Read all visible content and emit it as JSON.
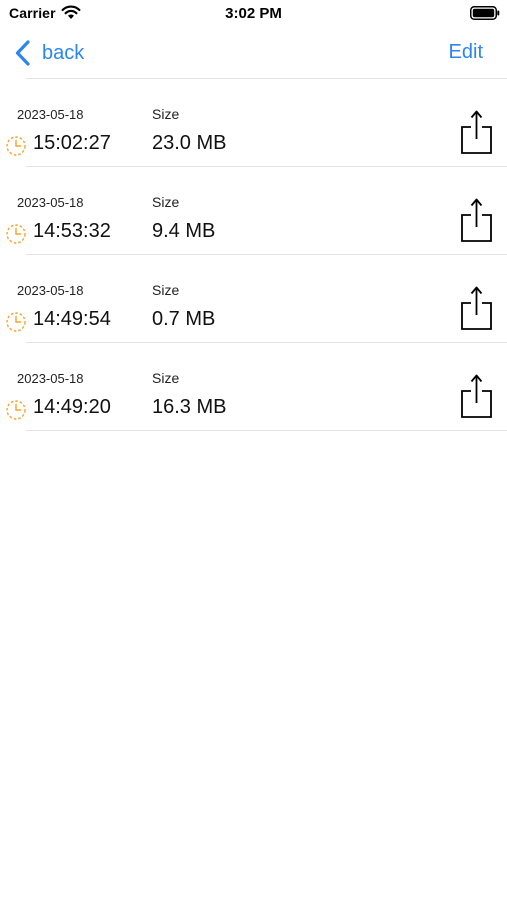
{
  "status_bar": {
    "carrier": "Carrier",
    "time": "3:02 PM",
    "wifi_icon": "wifi-icon",
    "battery_icon": "battery-icon"
  },
  "nav": {
    "back_label": "back",
    "edit_label": "Edit",
    "accent_color": "#2a86f1"
  },
  "recordings": [
    {
      "date": "2023-05-18",
      "time": "15:02:27",
      "size_label": "Size",
      "size": "23.0 MB"
    },
    {
      "date": "2023-05-18",
      "time": "14:53:32",
      "size_label": "Size",
      "size": "9.4 MB"
    },
    {
      "date": "2023-05-18",
      "time": "14:49:54",
      "size_label": "Size",
      "size": "0.7 MB"
    },
    {
      "date": "2023-05-18",
      "time": "14:49:20",
      "size_label": "Size",
      "size": "16.3 MB"
    }
  ],
  "icons": {
    "row_leading": "clock-icon",
    "row_trailing": "share-icon",
    "clock_color": "#f5a623"
  }
}
